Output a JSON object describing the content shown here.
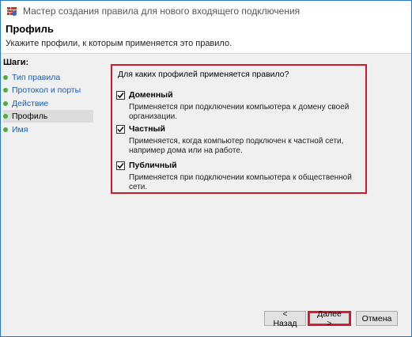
{
  "window": {
    "title": "Мастер создания правила для нового входящего подключения"
  },
  "header": {
    "title": "Профиль",
    "subtitle": "Укажите профили, к которым применяется это правило."
  },
  "sidebar": {
    "steps_label": "Шаги:",
    "items": [
      {
        "label": "Тип правила"
      },
      {
        "label": "Протокол и порты"
      },
      {
        "label": "Действие"
      },
      {
        "label": "Профиль"
      },
      {
        "label": "Имя"
      }
    ]
  },
  "content": {
    "question": "Для каких профилей применяется правило?",
    "profiles": [
      {
        "label": "Доменный",
        "checked": true,
        "description": "Применяется при подключении компьютера к домену своей организации."
      },
      {
        "label": "Частный",
        "checked": true,
        "description": "Применяется, когда компьютер подключен к частной сети, например дома или на работе."
      },
      {
        "label": "Публичный",
        "checked": true,
        "description": "Применяется при подключении компьютера к общественной сети."
      }
    ]
  },
  "buttons": {
    "back": "< Назад",
    "next": "Далее >",
    "cancel": "Отмена"
  },
  "colors": {
    "highlight": "#d4182a",
    "step_dot": "#4caf3d",
    "link": "#1a5fb4"
  },
  "icons": {
    "window": "firewall-icon",
    "step": "green-dot-icon",
    "check": "checkmark-icon"
  }
}
